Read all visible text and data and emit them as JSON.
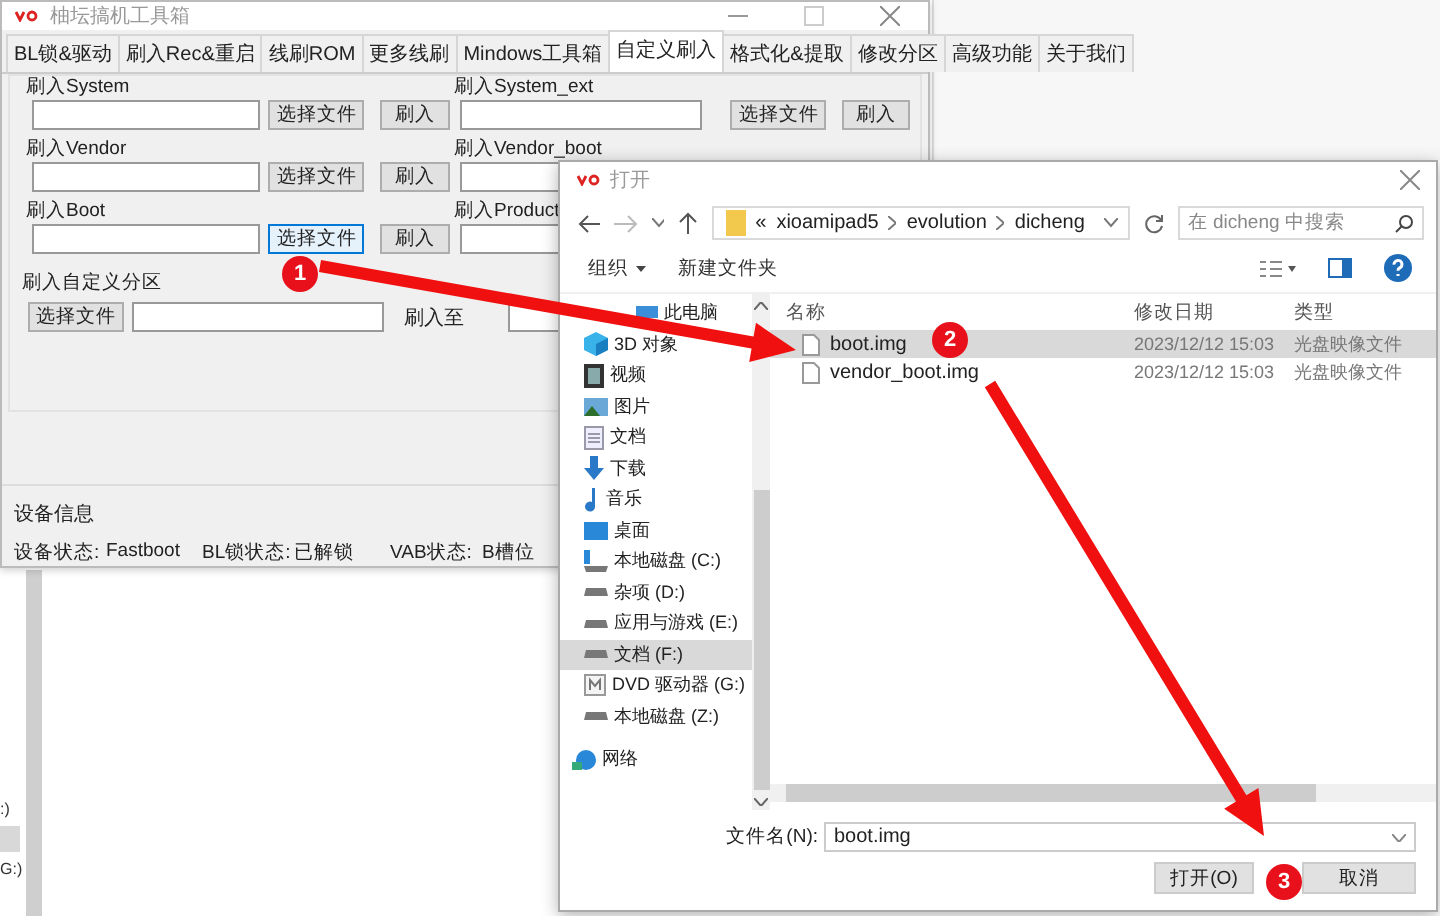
{
  "background_window": {
    "sidebar_fragments": [
      {
        "text": ":)",
        "selected": false
      },
      {
        "selected": true
      },
      {
        "text": "G:)",
        "selected": false
      }
    ]
  },
  "tool_window": {
    "title": "柚坛搞机工具箱",
    "tabs": [
      {
        "label": "BL锁&驱动",
        "selected": false
      },
      {
        "label": "刷入Rec&重启",
        "selected": false
      },
      {
        "label": "线刷ROM",
        "selected": false
      },
      {
        "label": "更多线刷",
        "selected": false
      },
      {
        "label": "Mindows工具箱",
        "selected": false
      },
      {
        "label": "自定义刷入",
        "selected": true
      },
      {
        "label": "格式化&提取",
        "selected": false
      },
      {
        "label": "修改分区",
        "selected": false
      },
      {
        "label": "高级功能",
        "selected": false
      },
      {
        "label": "关于我们",
        "selected": false
      }
    ],
    "flash_groups": [
      {
        "label": "刷入System",
        "buttons": [
          {
            "label": "选择文件",
            "focused": false
          },
          {
            "label": "刷入",
            "focused": false
          }
        ]
      },
      {
        "label": "刷入System_ext",
        "buttons": [
          {
            "label": "选择文件",
            "focused": false
          },
          {
            "label": "刷入",
            "focused": false
          }
        ]
      },
      {
        "label": "刷入Vendor",
        "buttons": [
          {
            "label": "选择文件",
            "focused": false
          },
          {
            "label": "刷入",
            "focused": false
          }
        ]
      },
      {
        "label": "刷入Vendor_boot"
      },
      {
        "label": "刷入Boot",
        "buttons": [
          {
            "label": "选择文件",
            "focused": true
          },
          {
            "label": "刷入",
            "focused": false
          }
        ]
      },
      {
        "label": "刷入Product"
      }
    ],
    "custom_partition": {
      "label": "刷入自定义分区",
      "button": "选择文件",
      "target_label": "刷入至"
    },
    "device_info": {
      "title": "设备信息",
      "fields": [
        {
          "label": "设备状态:",
          "value": "Fastboot"
        },
        {
          "label": "BL锁状态:",
          "value": "已解锁"
        },
        {
          "label": "VAB状态:",
          "value": "B槽位"
        }
      ]
    }
  },
  "open_dialog": {
    "title": "打开",
    "path": [
      "«",
      "xioamipad5",
      "evolution",
      "dicheng"
    ],
    "search": {
      "placeholder": "在 dicheng 中搜索"
    },
    "toolbar": {
      "organize": "组织",
      "new_folder": "新建文件夹"
    },
    "sidebar": [
      {
        "label": "此电脑",
        "kind": "computer",
        "selected": false,
        "children": [
          {
            "label": "3D 对象",
            "kind": "cube",
            "selected": false
          },
          {
            "label": "视频",
            "kind": "film",
            "selected": false
          },
          {
            "label": "图片",
            "kind": "picture",
            "selected": false
          },
          {
            "label": "文档",
            "kind": "document",
            "selected": false
          },
          {
            "label": "下载",
            "kind": "download",
            "selected": false
          },
          {
            "label": "音乐",
            "kind": "music",
            "selected": false
          },
          {
            "label": "桌面",
            "kind": "desktop",
            "selected": false
          },
          {
            "label": "本地磁盘 (C:)",
            "kind": "system-drive",
            "selected": false
          },
          {
            "label": "杂项 (D:)",
            "kind": "drive",
            "selected": false
          },
          {
            "label": "应用与游戏 (E:)",
            "kind": "drive",
            "selected": false
          },
          {
            "label": "文档 (F:)",
            "kind": "drive",
            "selected": true
          },
          {
            "label": "DVD 驱动器 (G:)",
            "kind": "dvd",
            "selected": false
          },
          {
            "label": "本地磁盘 (Z:)",
            "kind": "drive",
            "selected": false
          }
        ]
      },
      {
        "label": "网络",
        "kind": "network",
        "selected": false
      }
    ],
    "columns": [
      "名称",
      "修改日期",
      "类型"
    ],
    "files": [
      {
        "name": "boot.img",
        "modified": "2023/12/12 15:03",
        "type": "光盘映像文件",
        "selected": true
      },
      {
        "name": "vendor_boot.img",
        "modified": "2023/12/12 15:03",
        "type": "光盘映像文件",
        "selected": false
      }
    ],
    "filename_label": "文件名(N):",
    "filename": "boot.img",
    "buttons": [
      "打开(O)",
      "取消"
    ]
  },
  "annotations": [
    {
      "label": "1"
    },
    {
      "label": "2"
    },
    {
      "label": "3"
    }
  ]
}
